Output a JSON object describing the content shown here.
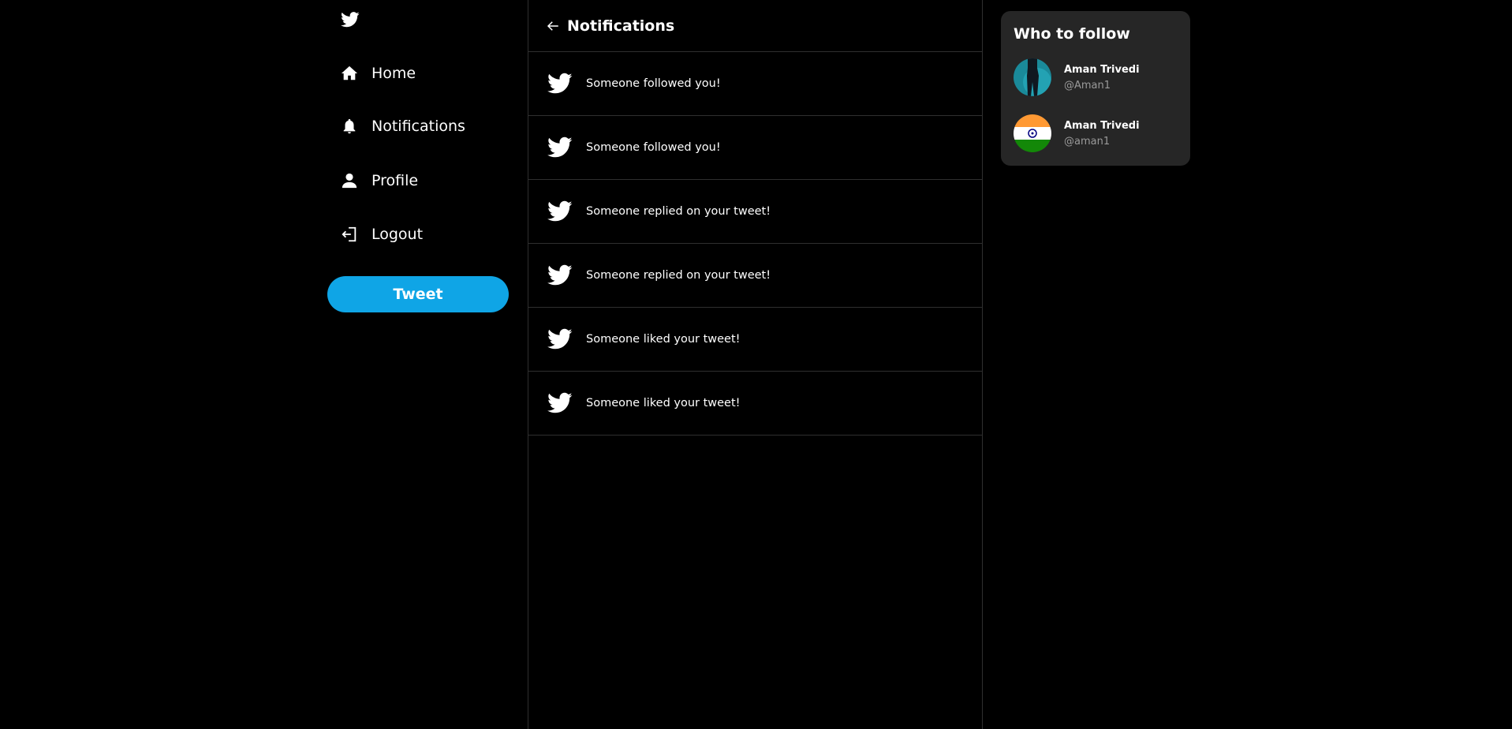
{
  "sidebar": {
    "logo_icon": "twitter-bird-icon",
    "items": [
      {
        "label": "Home",
        "icon": "home-icon"
      },
      {
        "label": "Notifications",
        "icon": "bell-icon"
      },
      {
        "label": "Profile",
        "icon": "user-icon"
      },
      {
        "label": "Logout",
        "icon": "logout-icon"
      }
    ],
    "tweet_label": "Tweet"
  },
  "main": {
    "title": "Notifications",
    "back_icon": "arrow-left-icon",
    "notifications": [
      {
        "text": "Someone followed you!"
      },
      {
        "text": "Someone followed you!"
      },
      {
        "text": "Someone replied on your tweet!"
      },
      {
        "text": "Someone replied on your tweet!"
      },
      {
        "text": "Someone liked your tweet!"
      },
      {
        "text": "Someone liked your tweet!"
      }
    ]
  },
  "who_to_follow": {
    "title": "Who to follow",
    "users": [
      {
        "name": "Aman Trivedi",
        "handle": "@Aman1"
      },
      {
        "name": "Aman Trivedi",
        "handle": "@aman1"
      }
    ]
  },
  "colors": {
    "accent": "#0fa5e6",
    "card_bg": "#262626",
    "background": "#000000"
  }
}
